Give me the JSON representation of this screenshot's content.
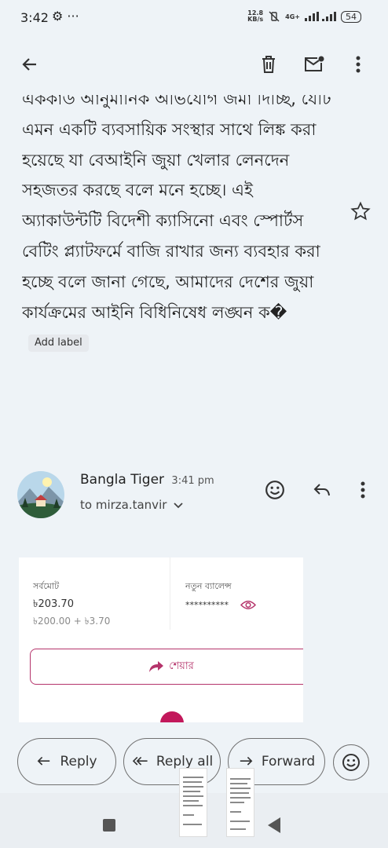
{
  "status_bar": {
    "time": "3:42",
    "left_icons": "⚙ ···",
    "net_speed_value": "12.8",
    "net_speed_unit": "KB/s",
    "network_label": "4G+",
    "battery": "54"
  },
  "toolbar": {
    "back_icon": "arrow-left-icon",
    "delete_icon": "trash-icon",
    "mark_unread_icon": "mail-unread-icon",
    "more_icon": "more-vert-icon"
  },
  "message_body": {
    "text": "এককাউ আনুমানিক অভিযোগ জমা দিচ্ছি, যেটি এমন একটি ব্যবসায়িক সংস্থার সাথে লিঙ্ক করা হয়েছে যা বেআইনি জুয়া খেলার লেনদেন সহজতর করছে বলে মনে হচ্ছে। এই অ্যাকাউন্টটি বিদেশী ক্যাসিনো এবং স্পোর্টস বেটিং প্ল্যাটফর্মে বাজি রাখার জন্য ব্যবহার করা হচ্ছে বলে জানা গেছে, আমাদের দেশের জুয়া কার্যক্রমের আইনি বিধিনিষেধ লঙ্ঘন ক�",
    "add_label": "Add label"
  },
  "sender": {
    "name": "Bangla Tiger",
    "time": "3:41 pm",
    "to": "to mirza.tanvir"
  },
  "attachment_preview": {
    "total_label": "সর্বমোট",
    "total_amount": "৳203.70",
    "total_breakdown": "৳200.00 + ৳3.70",
    "balance_label": "নতুন ব্যালেন্স",
    "balance_masked": "**********",
    "share_label": "শেয়ার"
  },
  "actions": {
    "reply": "Reply",
    "reply_all": "Reply all",
    "forward": "Forward"
  },
  "colors": {
    "background": "#eef3f7",
    "accent_pink": "#b5346b"
  }
}
